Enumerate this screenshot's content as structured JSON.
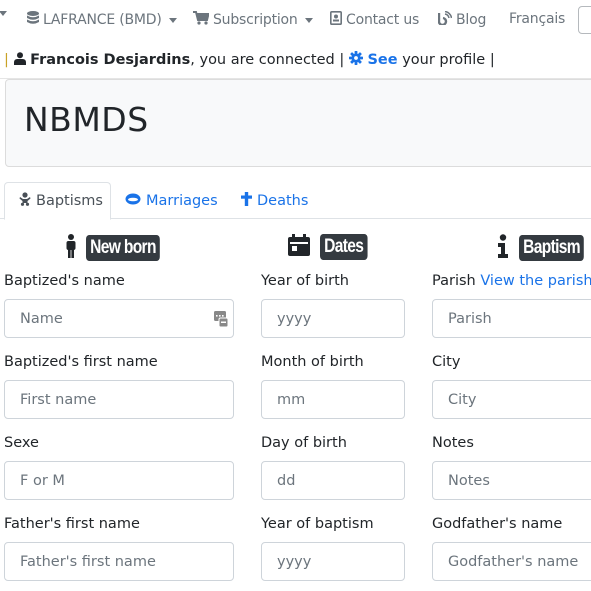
{
  "navbar": {
    "items": [
      {
        "label": "LAFRANCE (BMD)",
        "icon": "database-icon",
        "dropdown": true
      },
      {
        "label": "Subscription",
        "icon": "cart-icon",
        "dropdown": true
      },
      {
        "label": "Contact us",
        "icon": "contact-card-icon",
        "dropdown": false
      },
      {
        "label": "Blog",
        "icon": "blog-rss-icon",
        "dropdown": false
      },
      {
        "label": "Français",
        "icon": null,
        "dropdown": false
      }
    ]
  },
  "userbar": {
    "separator": "|",
    "user_name": "Francois Desjardins",
    "connected_text": ", you are connected",
    "see_label": "See",
    "profile_text": "your profile"
  },
  "page_title": "NBMDS",
  "tabs": [
    {
      "label": "Baptisms",
      "icon": "baby-icon",
      "active": true
    },
    {
      "label": "Marriages",
      "icon": "ring-icon",
      "active": false
    },
    {
      "label": "Deaths",
      "icon": "cross-icon",
      "active": false
    }
  ],
  "sections": {
    "newborn": {
      "title": "New born",
      "icon": "person-icon"
    },
    "dates": {
      "title": "Dates",
      "icon": "calendar-icon"
    },
    "baptism": {
      "title": "Baptism",
      "icon": "info-icon"
    }
  },
  "form": {
    "col1": [
      {
        "label": "Baptized's name",
        "placeholder": "Name",
        "value": ""
      },
      {
        "label": "Baptized's first name",
        "placeholder": "First name",
        "value": ""
      },
      {
        "label": "Sexe",
        "placeholder": "F or M",
        "value": ""
      },
      {
        "label": "Father's first name",
        "placeholder": "Father's first name",
        "value": ""
      }
    ],
    "col2": [
      {
        "label": "Year of birth",
        "placeholder": "yyyy",
        "value": ""
      },
      {
        "label": "Month of birth",
        "placeholder": "mm",
        "value": ""
      },
      {
        "label": "Day of birth",
        "placeholder": "dd",
        "value": ""
      },
      {
        "label": "Year of baptism",
        "placeholder": "yyyy",
        "value": ""
      }
    ],
    "col3": [
      {
        "label": "Parish",
        "link": "View the parishes",
        "placeholder": "Parish",
        "value": ""
      },
      {
        "label": "City",
        "placeholder": "City",
        "value": ""
      },
      {
        "label": "Notes",
        "placeholder": "Notes",
        "value": ""
      },
      {
        "label": "Godfather's name",
        "placeholder": "Godfather's name",
        "value": ""
      }
    ]
  },
  "colors": {
    "link": "#1a73e8",
    "badge_bg": "#343a40",
    "nav_text": "#6c757d",
    "jumbotron_bg": "#f8f9fa"
  }
}
